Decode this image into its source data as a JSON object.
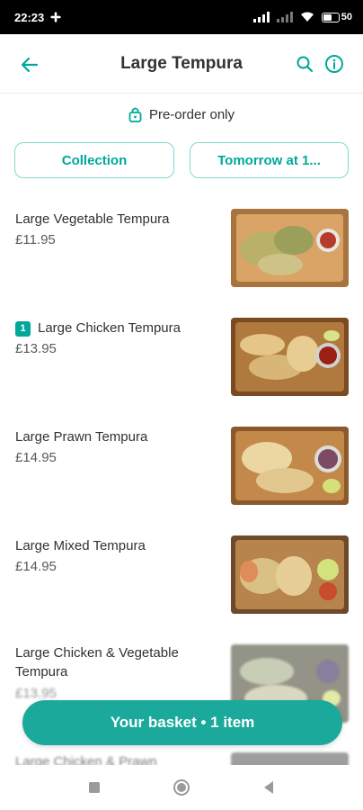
{
  "status_bar": {
    "time": "22:23",
    "battery": "50"
  },
  "header": {
    "title": "Large Tempura"
  },
  "preorder": {
    "label": "Pre-order only"
  },
  "options": {
    "fulfilment": "Collection",
    "schedule": "Tomorrow at 1..."
  },
  "items": [
    {
      "name": "Large Vegetable Tempura",
      "price": "£11.95",
      "quantity": ""
    },
    {
      "name": "Large Chicken Tempura",
      "price": "£13.95",
      "quantity": "1"
    },
    {
      "name": "Large Prawn Tempura",
      "price": "£14.95",
      "quantity": ""
    },
    {
      "name": "Large Mixed Tempura",
      "price": "£14.95",
      "quantity": ""
    },
    {
      "name": "Large Chicken & Vegetable Tempura",
      "price": "£13.95",
      "quantity": ""
    },
    {
      "name": "Large Chicken & Prawn",
      "price": "",
      "quantity": ""
    }
  ],
  "basket": {
    "label": "Your basket • 1 item"
  },
  "colors": {
    "accent": "#00ccbc",
    "accent_dark": "#00a89a",
    "text": "#2e3333"
  }
}
